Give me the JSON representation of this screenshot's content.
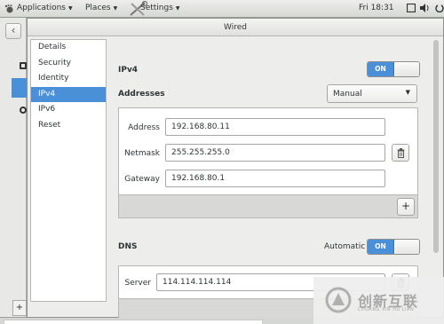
{
  "topbar": {
    "applications": "Applications",
    "places": "Places",
    "settings": "Settings",
    "clock": "Fri 18:31"
  },
  "dialog": {
    "title": "Wired",
    "sidebar": [
      "Details",
      "Security",
      "Identity",
      "IPv4",
      "IPv6",
      "Reset"
    ],
    "active_item": "IPv4"
  },
  "ipv4": {
    "heading": "IPv4",
    "toggle": "ON",
    "addresses_label": "Addresses",
    "method": "Manual",
    "address_label": "Address",
    "address_value": "192.168.80.11",
    "netmask_label": "Netmask",
    "netmask_value": "255.255.255.0",
    "gateway_label": "Gateway",
    "gateway_value": "192.168.80.1",
    "add_label": "+"
  },
  "dns": {
    "heading": "DNS",
    "automatic_label": "Automatic",
    "toggle": "ON",
    "server_label": "Server",
    "server_value": "114.114.114.114"
  },
  "watermark": {
    "cn": "创新互联",
    "en": "CHUANG XIN HU LIAN"
  },
  "colors": {
    "accent": "#4a90d9"
  }
}
